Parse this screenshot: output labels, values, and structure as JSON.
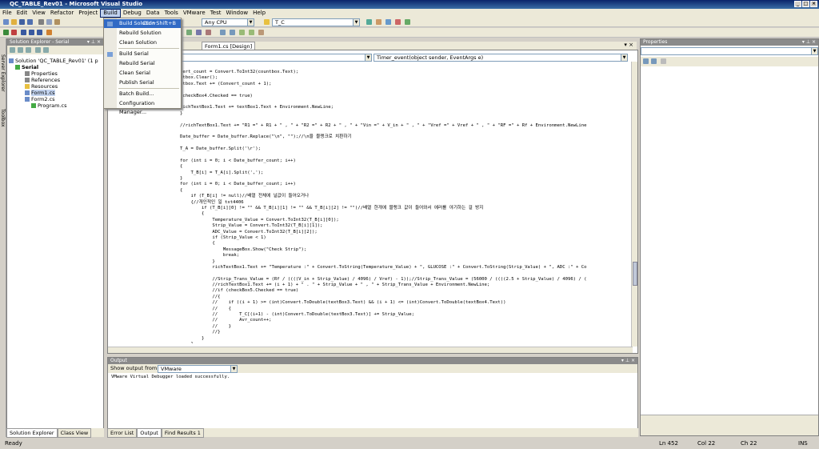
{
  "window": {
    "title": "QC_TABLE_Rev01 - Microsoft Visual Studio"
  },
  "menubar": [
    "File",
    "Edit",
    "View",
    "Refactor",
    "Project",
    "Build",
    "Debug",
    "Data",
    "Tools",
    "VMware",
    "Test",
    "Window",
    "Help"
  ],
  "toolbar": {
    "platform": "Any CPU",
    "find": "T_C"
  },
  "build_menu": {
    "items": [
      {
        "label": "Build Solution",
        "shortcut": "Ctrl+Shift+B"
      },
      {
        "label": "Rebuild Solution"
      },
      {
        "label": "Clean Solution"
      },
      {
        "label": "Build Serial"
      },
      {
        "label": "Rebuild Serial"
      },
      {
        "label": "Clean Serial"
      },
      {
        "label": "Publish Serial"
      },
      {
        "label": "Batch Build..."
      },
      {
        "label": "Configuration Manager..."
      }
    ]
  },
  "left_strip": {
    "server_explorer": "Server Explorer",
    "toolbox": "Toolbox"
  },
  "solution_explorer": {
    "title": "Solution Explorer - Serial",
    "tree": [
      "Solution 'QC_TABLE_Rev01' (1 p",
      "Serial",
      "Properties",
      "References",
      "Resources",
      "Form1.cs",
      "Form2.cs",
      "Program.cs"
    ]
  },
  "editor": {
    "tabs": [
      "Form1.cs [Design]"
    ],
    "member": "Timer_event(object sender, EventArgs e)",
    "lines": [
      "vert_count = Convert.ToInt32(countbox.Text);",
      "ntbox.Clear();",
      "ntbox.Text += (Convert_count + 1);",
      "",
      "(checkBox4.Checked == true)",
      "",
      "richTextBox1.Text += textBox1.Text + Environment.NewLine;",
      "}",
      "",
      "//richTextBox1.Text += \"R1 =\" + R1 + \" , \" + \"R2 =\" + R2 + \" , \" + \"Vin =\" + V_in + \" , \" + \"Vref =\" + Vref + \" , \" + \"RF =\" + Rf + Environment.NewLine",
      "",
      "Date_buffer = Date_buffer.Replace(\"\\n\", \"\");//\\n을 블랭크로 치환하기",
      "",
      "T_A = Date_buffer.Split('\\r');",
      "",
      "for (int i = 0; i < Date_buffer_count; i++)",
      "{",
      "    T_B[i] = T_A[i].Split(',');",
      "}",
      "for (int i = 0; i < Date_buffer_count; i++)",
      "{",
      "    if (T_B[i] != null)//배열 전체에 널값이 들어오거나",
      "    {//개인적인 일 txt4406",
      "        if (T_B[i][0] != \"\" && T_B[i][1] != \"\" && T_B[i][2] != \"\")//배열 한개에 블랭크 값이 들어와서 에러를 야기하는 걸 방지",
      "        {",
      "            Temperature_Value = Convert.ToInt32(T_B[i][0]);",
      "            Strip_Value = Convert.ToInt32(T_B[i][1]);",
      "            ADC_Value = Convert.ToInt32(T_B[i][2]);",
      "            if (Strip_Value < 1)",
      "            {",
      "                MessageBox.Show(\"Check Strip\");",
      "                break;",
      "            }",
      "            richTextBox1.Text += \"Temperature :\" + Convert.ToString(Temperature_Value) + \", GLUCOSE :\" + Convert.ToString(Strip_Value) + \", ADC :\" + Co",
      "",
      "            //Strip_Trans_Value = (Rf / ((((V_in + Strip_Value) / 4096) / Vref) - 1));//Strip_Trans_Value = (56000 / ((((2.5 + Strip_Value) / 4096) / (",
      "            //richTextBox1.Text += (i + 1) + \" . \" + Strip_Value + \" , \" + Strip_Trans_Value + Environment.NewLine;",
      "            //if (checkBox5.Checked == true)",
      "            //{",
      "            //    if ((i + 1) >= (int)Convert.ToDouble(textBox3.Text) && (i + 1) <= (int)Convert.ToDouble(textBox4.Text))",
      "            //    {",
      "            //        T_C[(i+1) - (int)Convert.ToDouble(textBox3.Text)] += Strip_Value;",
      "            //        Avr_count++;",
      "            //    }",
      "            //}",
      "        }",
      "    }"
    ]
  },
  "output": {
    "title": "Output",
    "show_from_label": "Show output from:",
    "show_from_value": "VMware",
    "text": "VMware Virtual Debugger loaded successfully."
  },
  "bottom_tabs": [
    "Error List",
    "Output",
    "Find Results 1"
  ],
  "solution_tabs": [
    "Solution Explorer",
    "Class View"
  ],
  "properties": {
    "title": "Properties"
  },
  "status": {
    "ready": "Ready",
    "ln": "Ln 452",
    "col": "Col 22",
    "ch": "Ch 22",
    "mode": "INS"
  }
}
